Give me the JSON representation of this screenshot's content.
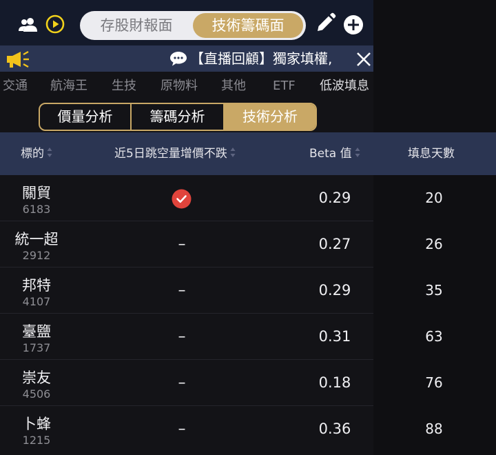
{
  "topbar": {
    "tabs": [
      "存股財報面",
      "技術籌碼面"
    ],
    "active_tab": "技術籌碼面",
    "icons": [
      "users-icon",
      "play-icon",
      "pencil-icon",
      "plus-circle-icon"
    ]
  },
  "notice": {
    "text": "【直播回顧】獨家填權,",
    "icons": [
      "megaphone-icon",
      "chat-bubble-icon",
      "close-icon"
    ]
  },
  "categories": [
    "交通",
    "航海王",
    "生技",
    "原物料",
    "其他",
    "ETF",
    "低波填息"
  ],
  "analysis_tabs": [
    "價量分析",
    "籌碼分析",
    "技術分析"
  ],
  "active_analysis_tab": "技術分析",
  "table": {
    "headers": {
      "stock": "標的",
      "gap": "近5日跳空量增價不跌",
      "beta": "Beta 值",
      "days": "填息天數"
    },
    "rows": [
      {
        "name": "關貿",
        "code": "6183",
        "gap": "",
        "gap_checked": true,
        "beta": "0.29",
        "days": "20"
      },
      {
        "name": "統一超",
        "code": "2912",
        "gap": "–",
        "gap_checked": false,
        "beta": "0.27",
        "days": "26"
      },
      {
        "name": "邦特",
        "code": "4107",
        "gap": "–",
        "gap_checked": false,
        "beta": "0.29",
        "days": "35"
      },
      {
        "name": "臺鹽",
        "code": "1737",
        "gap": "–",
        "gap_checked": false,
        "beta": "0.31",
        "days": "63"
      },
      {
        "name": "崇友",
        "code": "4506",
        "gap": "–",
        "gap_checked": false,
        "beta": "0.18",
        "days": "76"
      },
      {
        "name": "卜蜂",
        "code": "1215",
        "gap": "–",
        "gap_checked": false,
        "beta": "0.36",
        "days": "88"
      }
    ]
  },
  "colors": {
    "gold": "#c9a866",
    "navy": "#2b3552",
    "check_red": "#e0443c"
  }
}
